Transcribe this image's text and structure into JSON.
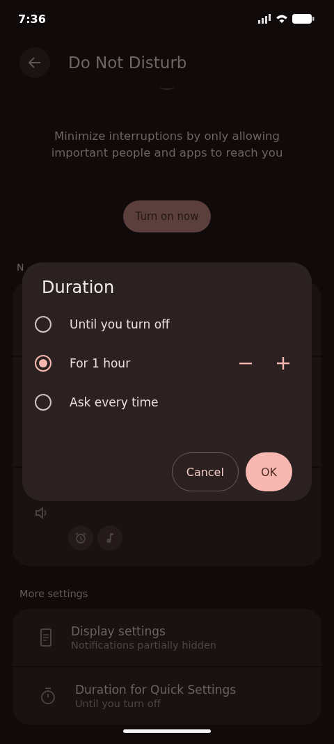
{
  "status_bar": {
    "time": "7:36"
  },
  "header": {
    "title": "Do Not Disturb"
  },
  "description": "Minimize interruptions by only allowing important people and apps to reach you",
  "primary_button": {
    "label": "Turn on now"
  },
  "covered_section": {
    "header": "N"
  },
  "more_settings": {
    "header": "More settings",
    "items": [
      {
        "kind": "display",
        "title": "Display settings",
        "subtitle": "Notifications partially hidden"
      },
      {
        "kind": "timer",
        "title": "Duration for Quick Settings",
        "subtitle": "Until you turn off"
      }
    ]
  },
  "dialog": {
    "title": "Duration",
    "options": [
      {
        "kind": "plain",
        "label": "Until you turn off",
        "selected": false
      },
      {
        "kind": "stepper",
        "label": "For 1 hour",
        "selected": true
      },
      {
        "kind": "plain",
        "label": "Ask every time",
        "selected": false
      }
    ],
    "buttons": [
      {
        "kind": "outlined",
        "label": "Cancel"
      },
      {
        "kind": "filled",
        "label": "OK"
      }
    ]
  }
}
